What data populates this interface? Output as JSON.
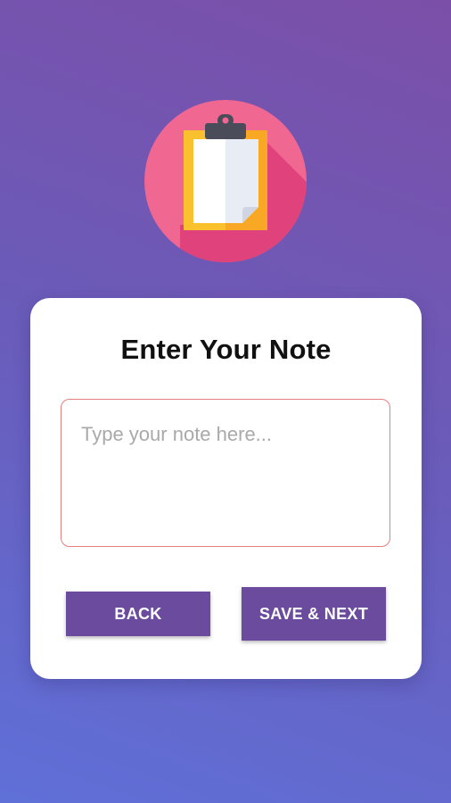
{
  "app": {
    "logo_icon": "clipboard-icon",
    "colors": {
      "background_top": "#7b4fa8",
      "background_bottom": "#5f70d8",
      "logo_circle": "#f06792",
      "button": "#6a4b9e",
      "input_border": "#e57f7f"
    }
  },
  "card": {
    "title": "Enter Your Note",
    "note_input": {
      "placeholder": "Type your note here...",
      "value": ""
    },
    "buttons": {
      "back_label": "BACK",
      "save_next_label": "SAVE & NEXT"
    }
  }
}
